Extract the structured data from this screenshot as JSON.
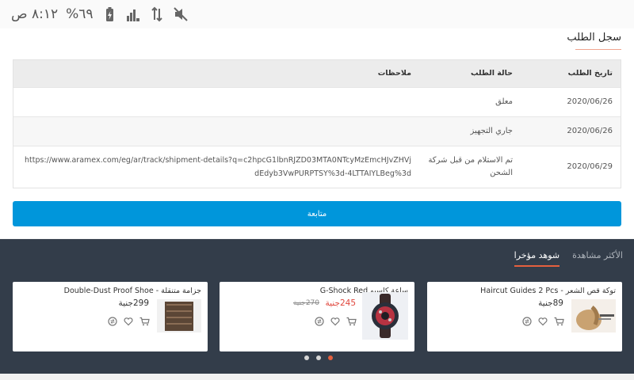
{
  "status_bar": {
    "time": "٨:١٢ ص",
    "battery": "٦٩%",
    "icons": [
      "battery-charging-icon",
      "signal-icon",
      "data-arrows-icon",
      "mute-icon"
    ]
  },
  "order_history": {
    "title": "سجل الطلب",
    "headers": {
      "date": "تاريخ الطلب",
      "status": "حالة الطلب",
      "notes": "ملاحظات"
    },
    "rows": [
      {
        "date": "2020/06/26",
        "status": "معلق",
        "notes": ""
      },
      {
        "date": "2020/06/26",
        "status": "جاري التجهيز",
        "notes": ""
      },
      {
        "date": "2020/06/29",
        "status": "تم الاستلام من قبل شركة الشحن",
        "notes": "https://www.aramex.com/eg/ar/track/shipment-details?q=c2hpcG1lbnRJZD03MTA0NTcyMzEmcHJvZHVjdEdyb3VwPURPTSY%3d-4LTTAIYLBeg%3d"
      }
    ],
    "follow_button": "متابعة"
  },
  "products": {
    "tabs": [
      {
        "label": "شوهد مؤخرا",
        "active": true
      },
      {
        "label": "الأكثر مشاهدة",
        "active": false
      }
    ],
    "cards": [
      {
        "name": "Haircut Guides 2 Pcs - توكة قص الشعر",
        "price": "89جنية",
        "old_price": "",
        "on_sale": false
      },
      {
        "name": "G-Shock Red ساعة كاسيو",
        "price": "245جنية",
        "old_price": "270جنية",
        "on_sale": true
      },
      {
        "name": "Double-Dust Proof Shoe - جزامة متنقلة",
        "price": "299جنية",
        "old_price": "",
        "on_sale": false
      }
    ],
    "pagination": {
      "count": 3,
      "active_index": 0
    },
    "colors": {
      "accent": "#e5603e",
      "button": "#0096db",
      "dark_bg": "#333d4a",
      "sale": "#e0463c"
    }
  }
}
